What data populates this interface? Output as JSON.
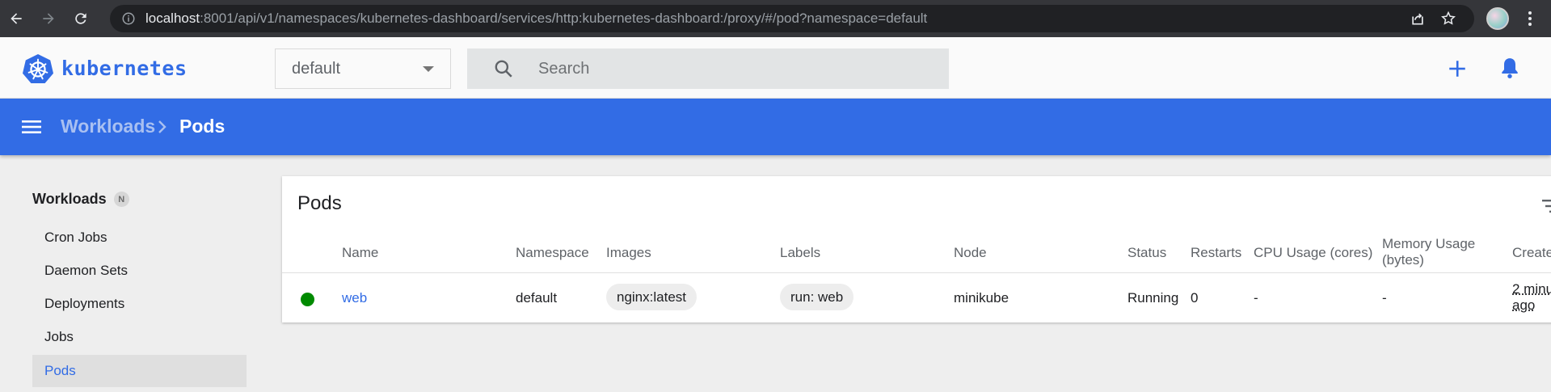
{
  "browser": {
    "url_host": "localhost",
    "url_rest": ":8001/api/v1/namespaces/kubernetes-dashboard/services/http:kubernetes-dashboard:/proxy/#/pod?namespace=default"
  },
  "header": {
    "logo_text": "kubernetes",
    "namespace_value": "default",
    "search_placeholder": "Search"
  },
  "toolbar": {
    "breadcrumb": [
      "Workloads",
      "Pods"
    ]
  },
  "sidebar": {
    "section_title": "Workloads",
    "section_badge": "N",
    "items": [
      {
        "label": "Cron Jobs",
        "active": false
      },
      {
        "label": "Daemon Sets",
        "active": false
      },
      {
        "label": "Deployments",
        "active": false
      },
      {
        "label": "Jobs",
        "active": false
      },
      {
        "label": "Pods",
        "active": true
      }
    ]
  },
  "card": {
    "title": "Pods",
    "columns": {
      "name": "Name",
      "namespace": "Namespace",
      "images": "Images",
      "labels": "Labels",
      "node": "Node",
      "status": "Status",
      "restarts": "Restarts",
      "cpu": "CPU Usage (cores)",
      "memory_line1": "Memory Usage",
      "memory_line2": "(bytes)",
      "created": "Create"
    },
    "rows": [
      {
        "name": "web",
        "namespace": "default",
        "image": "nginx:latest",
        "label": "run: web",
        "node": "minikube",
        "status": "Running",
        "restarts": "0",
        "cpu": "-",
        "memory": "-",
        "created_line1": "2 minu",
        "created_line2": "ago",
        "status_color": "#008a00"
      }
    ]
  },
  "colors": {
    "brand": "#326ce5",
    "status_running": "#008a00"
  }
}
